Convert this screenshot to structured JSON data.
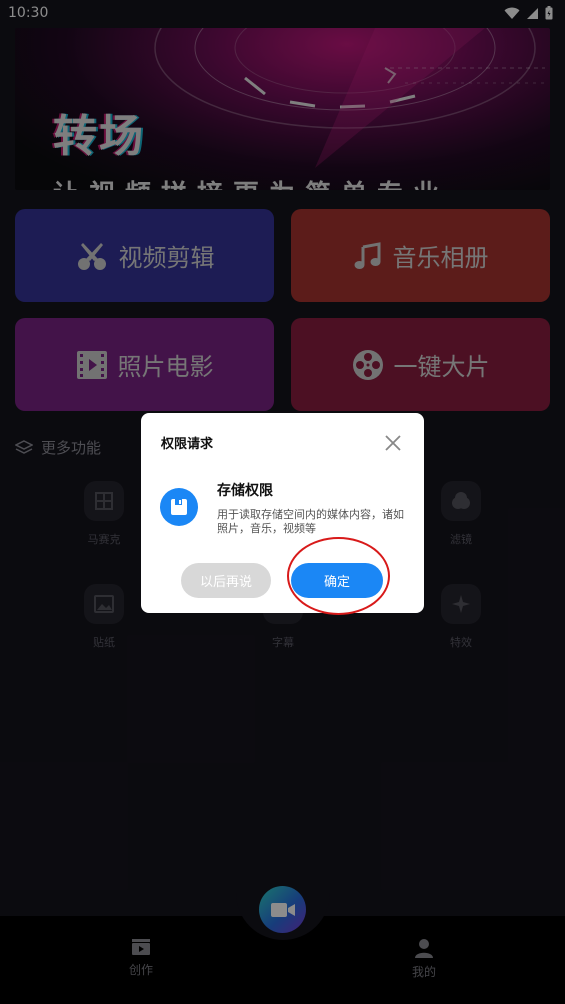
{
  "status_bar": {
    "time": "10:30"
  },
  "banner": {
    "title": "转场",
    "subtitle": "让视频拼接更为简单专业"
  },
  "tiles": {
    "video_edit": "视频剪辑",
    "music_album": "音乐相册",
    "photo_movie": "照片电影",
    "one_click": "一键大片"
  },
  "more": {
    "header": "更多功能",
    "items": [
      "马赛克",
      "滤镜",
      "贴纸",
      "字幕",
      "特效"
    ]
  },
  "dialog": {
    "title": "权限请求",
    "permission_name": "存储权限",
    "permission_desc": "用于读取存储空间内的媒体内容，诸如照片，音乐，视频等",
    "later_label": "以后再说",
    "ok_label": "确定"
  },
  "bottom_nav": {
    "create": "创作",
    "mine": "我的"
  },
  "colors": {
    "accent_blue": "#1b87f5",
    "highlight_red": "#d81a1a",
    "tile_video": "#36349a",
    "tile_music": "#a83430",
    "tile_photo": "#7a2385",
    "tile_oneclick": "#8b1e40"
  },
  "icons": {
    "video_edit": "scissors-icon",
    "music_album": "music-note-icon",
    "photo_movie": "film-strip-icon",
    "one_click": "film-reel-icon",
    "more": "layers-icon",
    "permission": "floppy-disk-icon",
    "fab": "video-camera-icon",
    "nav_create": "clapperboard-icon",
    "nav_mine": "person-icon"
  }
}
